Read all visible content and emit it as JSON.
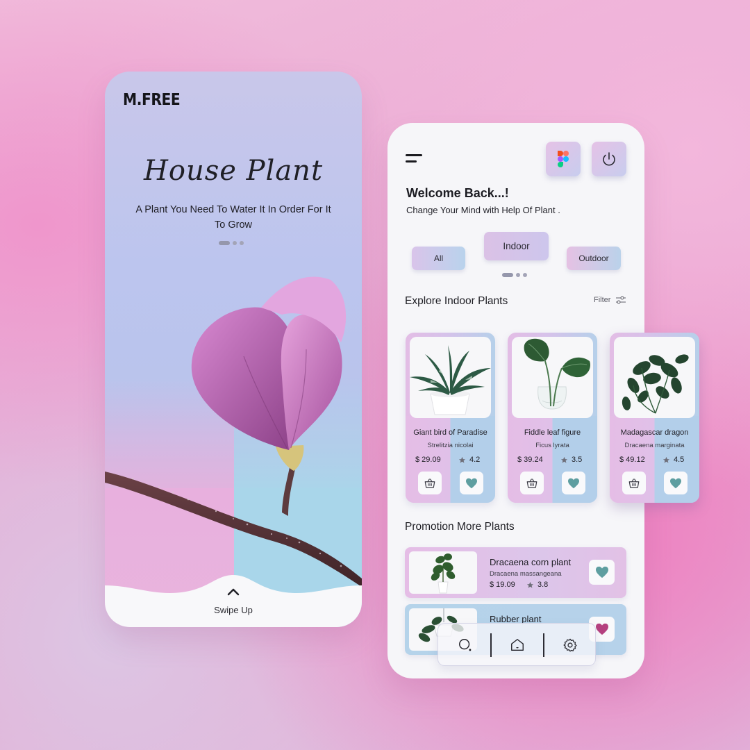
{
  "splash": {
    "brand": "M.FREE",
    "title": "House Plant",
    "tagline": "A Plant You Need To Water It In Order For It To Grow",
    "swipe_label": "Swipe Up"
  },
  "home": {
    "welcome": "Welcome Back...!",
    "subtitle": "Change Your Mind with Help Of Plant .",
    "categories": [
      "All",
      "Indoor",
      "Outdoor"
    ],
    "active_category": "Indoor",
    "explore_title": "Explore Indoor Plants",
    "filter_label": "Filter",
    "products": [
      {
        "name": "Giant bird of Paradise",
        "scientific": "Strelitzia nicolai",
        "price": "$ 29.09",
        "rating": "4.2"
      },
      {
        "name": "Fiddle leaf figure",
        "scientific": "Ficus lyrata",
        "price": "$ 39.24",
        "rating": "3.5"
      },
      {
        "name": "Madagascar dragon",
        "scientific": "Dracaena marginata",
        "price": "$ 49.12",
        "rating": "4.5"
      }
    ],
    "promo_title": "Promotion More Plants",
    "promotions": [
      {
        "name": "Dracaena corn plant",
        "scientific": "Dracaena massangeana",
        "price": "$ 19.09",
        "rating": "3.8",
        "heart_color": "#5e9ea0"
      },
      {
        "name": "Rubber plant",
        "scientific": "",
        "price": "",
        "rating": "",
        "heart_color": "#b5407f"
      }
    ],
    "nav": [
      "search-icon",
      "home-icon",
      "settings-icon"
    ]
  },
  "colors": {
    "accent_teal": "#5e9ea0",
    "accent_magenta": "#b5407f",
    "pink": "#e5bde6",
    "blue": "#b5d3ea"
  }
}
